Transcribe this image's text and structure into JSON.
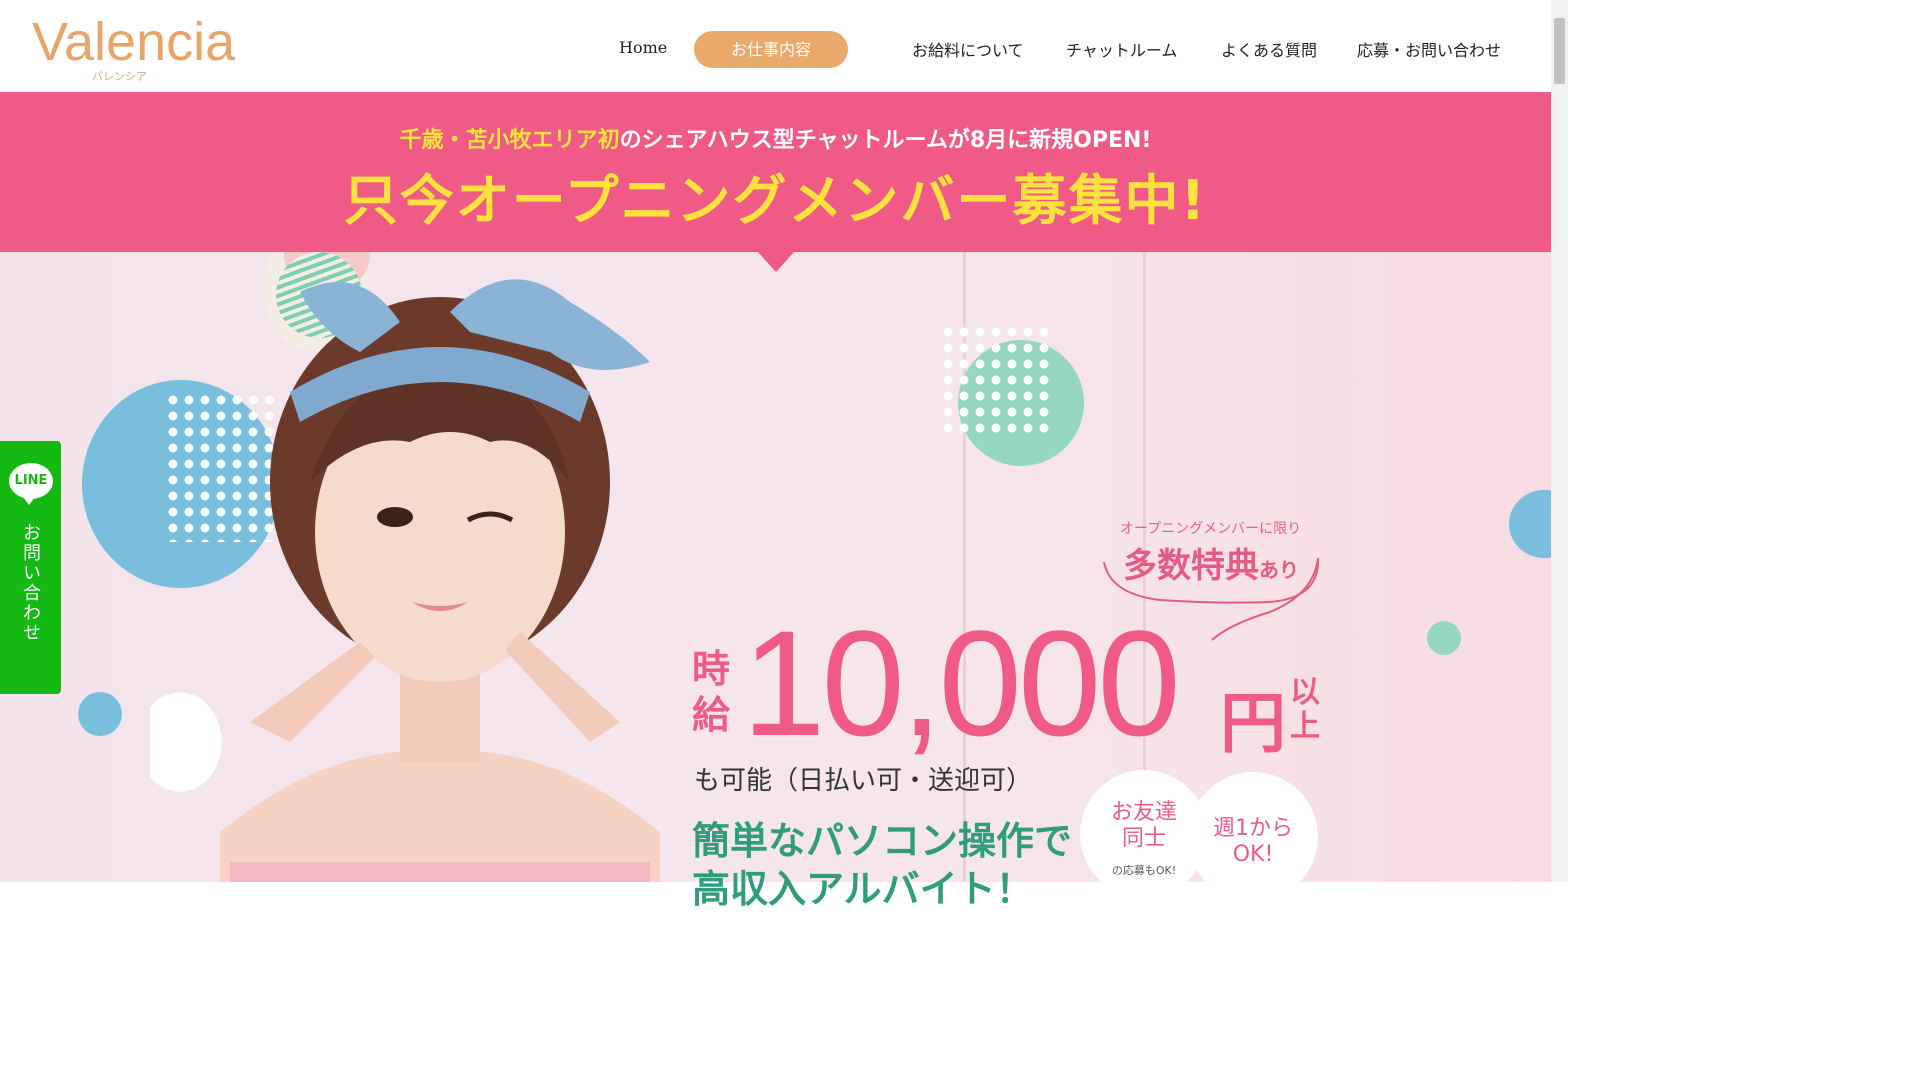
{
  "header": {
    "logo_main": "Valencia",
    "logo_sub": "バレンシア",
    "nav": {
      "home": "Home",
      "active": "お仕事内容",
      "salary": "お給料について",
      "chatroom": "チャットルーム",
      "faq": "よくある質問",
      "apply": "応募・お問い合わせ"
    }
  },
  "banner": {
    "line1_highlight": "千歳・苫小牧エリア初",
    "line1_rest": "のシェアハウス型チャットルームが8月に新規OPEN!",
    "line2": "只今オープニングメンバー募集中!"
  },
  "side_tab": {
    "line_label": "LINE",
    "text": "お問い合わせ"
  },
  "hero": {
    "caption_small": "オープニングメンバーに限り",
    "caption_big": "多数特典",
    "caption_big_suffix": "あり",
    "wage_label": "時給",
    "wage_amount": "10,000",
    "wage_yen": "円",
    "wage_ijo": "以上",
    "sub1": "も可能（日払い可・送迎可）",
    "sub2": "簡単なパソコン操作で",
    "sub3": "高収入アルバイト！",
    "badge1_title": "お友達同士",
    "badge1_note": "の応募もOK!",
    "badge2_title": "週1から OK!"
  },
  "colors": {
    "pink": "#ef5b86",
    "yellow": "#ffe23d",
    "orange": "#e8a96a",
    "green": "#2f9d7c",
    "line_green": "#14b914"
  }
}
